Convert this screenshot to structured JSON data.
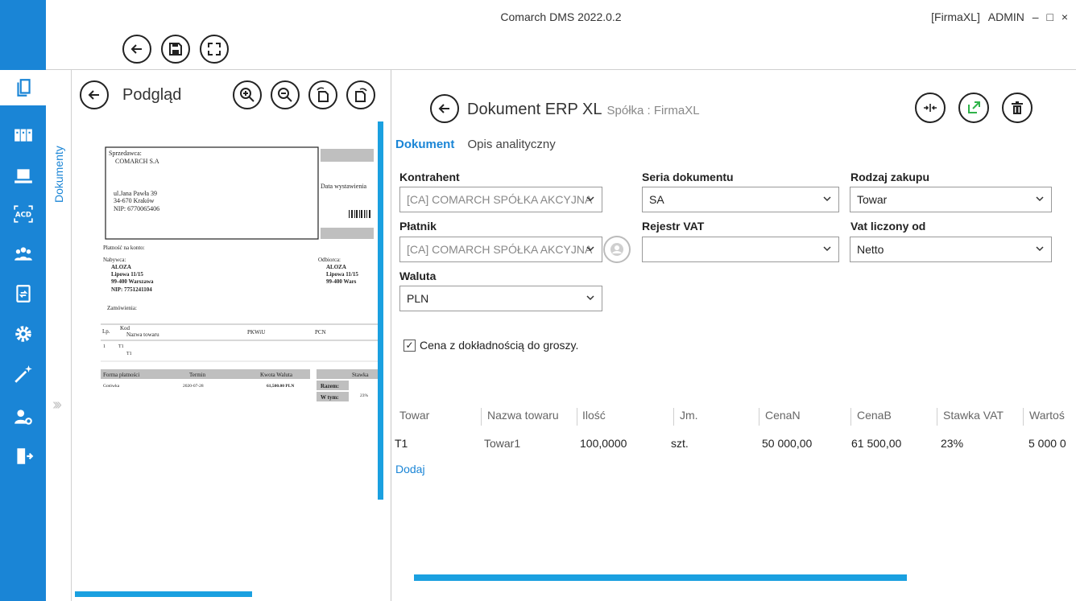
{
  "window": {
    "title": "Comarch DMS 2022.0.2",
    "company_tag": "[FirmaXL]",
    "user": "ADMIN",
    "minimize": "–",
    "maximize": "□",
    "close": "×"
  },
  "sidebar": {
    "items": [
      {
        "icon": "documents-icon"
      },
      {
        "icon": "repository-icon"
      },
      {
        "icon": "laptop-icon"
      },
      {
        "icon": "acd-icon"
      },
      {
        "icon": "users-icon"
      },
      {
        "icon": "exchange-icon"
      },
      {
        "icon": "gear-icon"
      },
      {
        "icon": "wand-icon"
      },
      {
        "icon": "user-admin-icon"
      },
      {
        "icon": "logout-icon"
      }
    ],
    "vertical_tab": "Dokumenty"
  },
  "preview": {
    "title": "Podgląd",
    "doc": {
      "seller_label": "Sprzedawca:",
      "seller_name": "COMARCH S.A",
      "seller_street": "ul.Jana Pawła 39",
      "seller_city": "34-670 Kraków",
      "seller_nip": "NIP: 6770065406",
      "date_label": "Data wystawienia",
      "payment_label": "Płatność na konto:",
      "buyer_label": "Nabywca:",
      "buyer_name": "ALOZA",
      "buyer_street": "Lipowa 11/15",
      "buyer_city": "99-400  Warszawa",
      "buyer_nip": "NIP: 7751241104",
      "recipient_label": "Odbiorca:",
      "recipient_name": "ALOZA",
      "recipient_street": "Lipowa 11/15",
      "recipient_city": "99-400  Wars",
      "orders_label": "Zamówienia:",
      "tbl_lp": "Lp.",
      "tbl_kod": "Kod",
      "tbl_nazwa": "Nazwa towaru",
      "tbl_pkwiu": "PKWiU",
      "tbl_pcn": "PCN",
      "row_lp": "1",
      "row_kod": "T1",
      "row_nazwa": "T1",
      "pay_form": "Forma płatności",
      "pay_term": "Termin",
      "pay_amount": "Kwota Waluta",
      "pay_method": "Gotówka",
      "pay_date": "2020-07-28",
      "pay_value": "61,500.00 PLN",
      "rate_label": "Stawka",
      "total_label": "Razem:",
      "incl_label": "W tym:",
      "incl_rate": "23%"
    }
  },
  "main": {
    "title": "Dokument ERP XL",
    "company": "Spółka : FirmaXL",
    "tabs": [
      {
        "label": "Dokument"
      },
      {
        "label": "Opis analityczny"
      }
    ],
    "fields": {
      "kontrahent_label": "Kontrahent",
      "kontrahent_value": "[CA] COMARCH SPÓŁKA AKCYJNA",
      "seria_label": "Seria dokumentu",
      "seria_value": "SA",
      "rodzaj_label": "Rodzaj zakupu",
      "rodzaj_value": "Towar",
      "platnik_label": "Płatnik",
      "platnik_value": "[CA] COMARCH SPÓŁKA AKCYJNA",
      "rejestr_label": "Rejestr VAT",
      "rejestr_value": "",
      "vat_label": "Vat liczony od",
      "vat_value": "Netto",
      "waluta_label": "Waluta",
      "waluta_value": "PLN"
    },
    "checkbox": {
      "label": "Cena z dokładnością do groszy.",
      "checked": true,
      "mark": "✓"
    },
    "grid": {
      "columns": [
        "Towar",
        "Nazwa towaru",
        "Ilość",
        "Jm.",
        "CenaN",
        "CenaB",
        "Stawka VAT",
        "Wartoś"
      ],
      "rows": [
        [
          "T1",
          "Towar1",
          "100,0000",
          "szt.",
          "50 000,00",
          "61 500,00",
          "23%",
          "5 000 0"
        ]
      ]
    },
    "add_label": "Dodaj"
  },
  "colors": {
    "accent": "#1a85d6",
    "scrollbar": "#1aa0e0",
    "green_action": "#2fb34a"
  }
}
